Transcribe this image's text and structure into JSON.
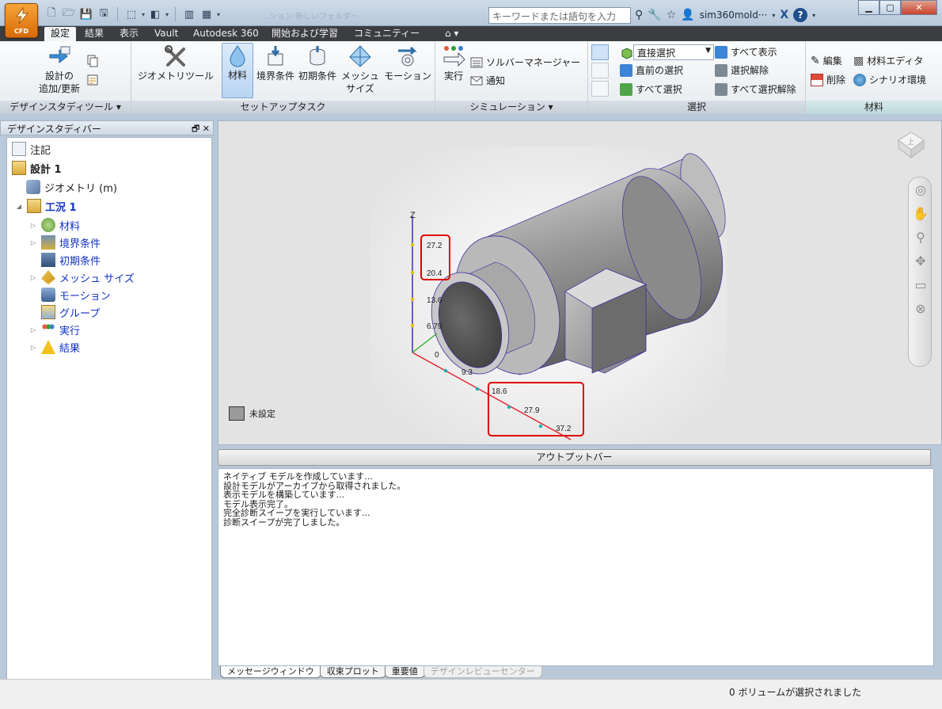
{
  "app": {
    "badge": "CFD",
    "faded_title": "…ション 新しいフォルダー",
    "search_placeholder": "キーワードまたは語句を入力",
    "user": "sim360mold···",
    "help": "?"
  },
  "tabs": [
    "設定",
    "結果",
    "表示",
    "Vault",
    "Autodesk 360",
    "開始および学習",
    "コミュニティー",
    "⌂ ▾"
  ],
  "ribbon": {
    "design_study": {
      "add_update": "設計の\n追加/更新",
      "label": "デザインスタディツール ▾"
    },
    "setup": {
      "geometry_tool": "ジオメトリツール",
      "materials": "材料",
      "boundary": "境界条件",
      "initial": "初期条件",
      "mesh": "メッシュ\nサイズ",
      "motion": "モーション",
      "label": "セットアップタスク"
    },
    "simulation": {
      "run": "実行",
      "solver_manager": "ソルバーマネージャー",
      "notify": "通知",
      "label": "シミュレーション ▾"
    },
    "selection": {
      "mode": "直接選択",
      "previous": "直前の選択",
      "select_all": "すべて選択",
      "show_all": "すべて表示",
      "deselect": "選択解除",
      "deselect_all": "すべて選択解除",
      "label": "選択"
    },
    "material": {
      "edit": "編集",
      "delete": "削除",
      "editor": "材料エディタ",
      "scenario": "シナリオ環境",
      "label": "材料"
    }
  },
  "sidebar": {
    "title": "デザインスタディバー",
    "items": [
      {
        "label": "注記"
      },
      {
        "label": "設計 1"
      },
      {
        "label": "ジオメトリ (m)"
      },
      {
        "label": "工況 1"
      },
      {
        "label": "材料"
      },
      {
        "label": "境界条件"
      },
      {
        "label": "初期条件"
      },
      {
        "label": "メッシュ サイズ"
      },
      {
        "label": "モーション"
      },
      {
        "label": "グループ"
      },
      {
        "label": "実行"
      },
      {
        "label": "結果"
      }
    ]
  },
  "viewport": {
    "axis_z": "Z",
    "z_ticks": [
      "27.2",
      "20.4",
      "13.6",
      "6.79",
      "0"
    ],
    "x_ticks": [
      "9.3",
      "18.6",
      "27.9",
      "37.2"
    ],
    "legend": "未設定",
    "navcube_text": "上",
    "colors": {
      "highlight": "#e00000",
      "z_axis": "#3a1eb4",
      "x_axis": "#e0202a",
      "y_axis": "#2faa2f"
    }
  },
  "output": {
    "header": "アウトプットバー",
    "lines": [
      "ネイティブ モデルを作成しています...",
      "設計モデルがアーカイブから取得されました。",
      "表示モデルを構築しています...",
      "モデル表示完了。",
      "完全診断スイープを実行しています...",
      "診断スイープが完了しました。"
    ],
    "tabs": [
      "メッセージウィンドウ",
      "収束プロット",
      "重要値",
      "デザインレビューセンター"
    ]
  },
  "status": "0 ボリュームが選択されました"
}
